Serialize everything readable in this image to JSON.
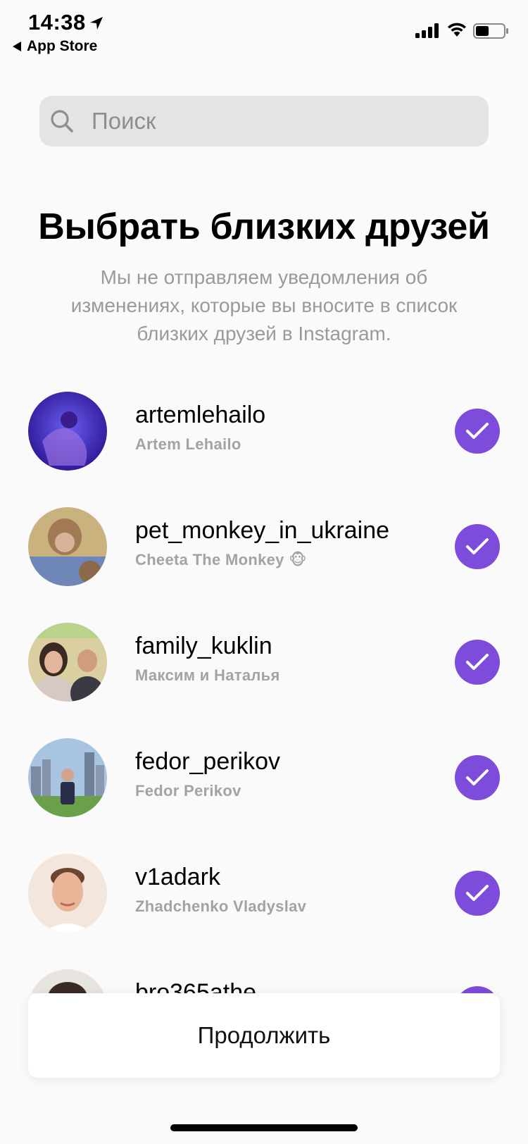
{
  "status_bar": {
    "time": "14:38",
    "back_app": "App Store"
  },
  "search": {
    "placeholder": "Поиск"
  },
  "header": {
    "title": "Выбрать близких друзей",
    "subtitle": "Мы не отправляем уведомления об изменениях, которые вы вносите в список близких друзей в Instagram."
  },
  "friends": [
    {
      "username": "artemlehailo",
      "name": "Artem Lehailo",
      "selected": true
    },
    {
      "username": "pet_monkey_in_ukraine",
      "name": "Cheeta The Monkey 🐵",
      "selected": true
    },
    {
      "username": "family_kuklin",
      "name": "Максим и Наталья",
      "selected": true
    },
    {
      "username": "fedor_perikov",
      "name": "Fedor Perikov",
      "selected": true
    },
    {
      "username": "v1adark",
      "name": "Zhadchenko Vladyslav",
      "selected": true
    },
    {
      "username": "bro365athe",
      "name": "",
      "selected": true
    }
  ],
  "continue_label": "Продолжить",
  "colors": {
    "accent": "#7d4cdb",
    "search_bg": "#e4e4e4",
    "secondary_text": "#a3a3a3"
  }
}
